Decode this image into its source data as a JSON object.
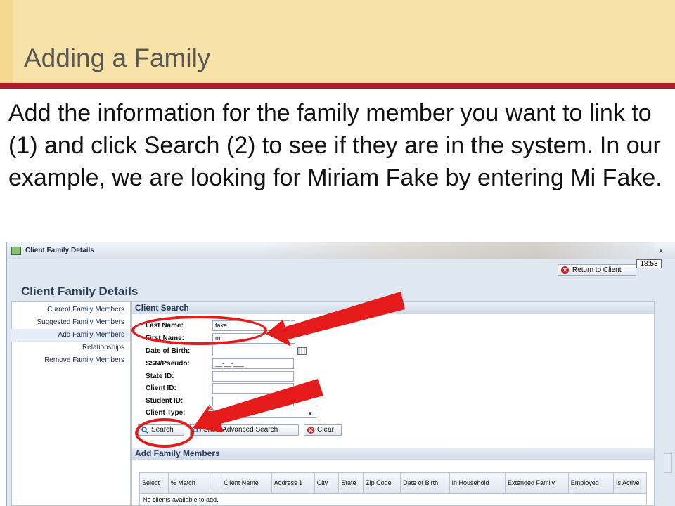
{
  "slide": {
    "title": "Adding a Family",
    "body": "Add the information for the family member you want to link to (1) and click Search (2) to see if they are in the system.  In our example, we are looking for Miriam Fake by entering Mi Fake."
  },
  "window": {
    "title": "Client Family Details",
    "time": "18:53",
    "close_symbol": "×",
    "return_button": "Return to Client",
    "page_heading": "Client Family Details"
  },
  "sidebar": {
    "items": [
      {
        "label": "Current Family Members"
      },
      {
        "label": "Suggested Family Members"
      },
      {
        "label": "Add Family Members"
      },
      {
        "label": "Relationships"
      },
      {
        "label": "Remove Family Members"
      }
    ],
    "active_index": 2
  },
  "client_search": {
    "header": "Client Search",
    "fields": {
      "last_name": {
        "label": "Last Name:",
        "value": "fake"
      },
      "first_name": {
        "label": "First Name:",
        "value": "mi"
      },
      "dob": {
        "label": "Date of Birth:",
        "value": ""
      },
      "ssn": {
        "label": "SSN/Pseudo:",
        "value": "__-__-___"
      },
      "state_id": {
        "label": "State ID:",
        "value": ""
      },
      "client_id": {
        "label": "Client ID:",
        "value": ""
      },
      "student_id": {
        "label": "Student ID:",
        "value": ""
      },
      "client_type": {
        "label": "Client Type:",
        "value": ""
      }
    },
    "buttons": {
      "search": "Search",
      "advanced": "Show Advanced Search",
      "clear": "Clear"
    }
  },
  "add_family_members": {
    "header": "Add Family Members",
    "columns": [
      "Select",
      "% Match",
      "",
      "Client Name",
      "Address 1",
      "City",
      "State",
      "Zip Code",
      "Date of Birth",
      "In Household",
      "Extended Family",
      "Employed",
      "Is Active"
    ],
    "empty_message": "No clients available to add."
  },
  "annotations": {
    "callout_1": "1",
    "callout_2": "2",
    "color": "#e51a1a"
  },
  "colors": {
    "header_band": "#f7e3a8",
    "accent_rule": "#b01c2e",
    "panel_header": "#cfdae8"
  }
}
